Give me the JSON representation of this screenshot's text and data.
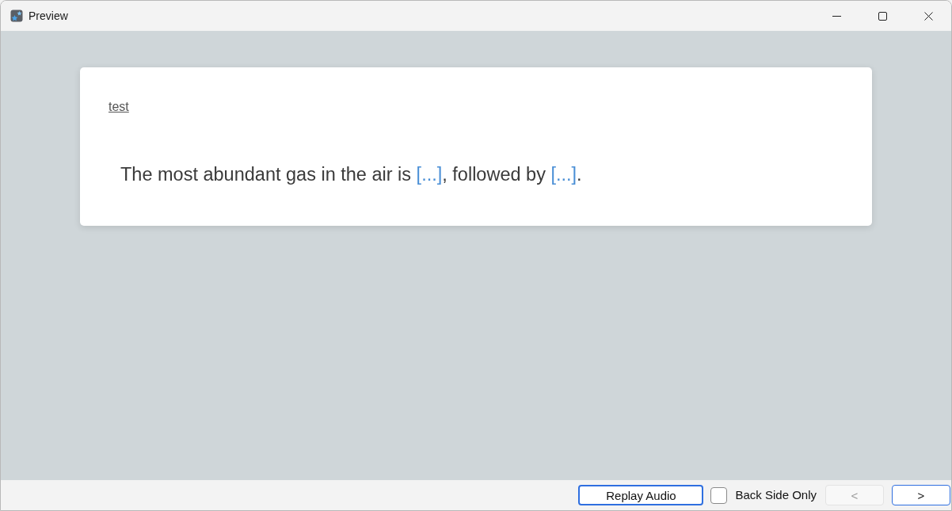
{
  "window": {
    "title": "Preview"
  },
  "card": {
    "tag_link": "test",
    "text_parts": [
      {
        "kind": "text",
        "text": "The most abundant gas in the air is "
      },
      {
        "kind": "cloze",
        "text": "[...]"
      },
      {
        "kind": "text",
        "text": ", followed by "
      },
      {
        "kind": "cloze",
        "text": "[...]"
      },
      {
        "kind": "text",
        "text": "."
      }
    ]
  },
  "bottom_bar": {
    "replay_button": {
      "label": "Replay Audio",
      "focused": true
    },
    "back_side_only": {
      "label": "Back Side Only",
      "checked": false
    },
    "prev_button": {
      "label": "<",
      "disabled": true
    },
    "next_button": {
      "label": ">",
      "disabled": false,
      "default": true
    }
  }
}
